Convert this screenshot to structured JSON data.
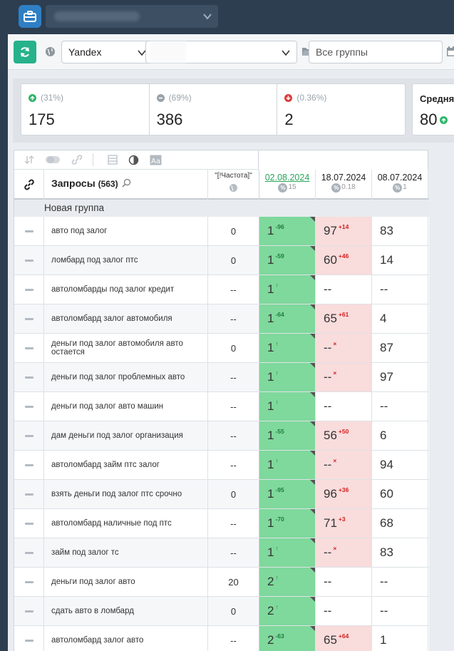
{
  "toolbar": {
    "search_engine": "Yandex",
    "group_placeholder": "Все группы"
  },
  "stats": [
    {
      "pct": "(31%)",
      "value": "175",
      "type": "up",
      "color": "#2fb66a"
    },
    {
      "pct": "(69%)",
      "value": "386",
      "type": "same",
      "color": "#9aa3ab"
    },
    {
      "pct": "(0.36%)",
      "value": "2",
      "type": "down",
      "color": "#e03b3b"
    }
  ],
  "avg": {
    "label": "Средня",
    "value": "80"
  },
  "table": {
    "query_header": "Запросы",
    "query_count": "(563)",
    "freq_header": "\"[!Частота]\"",
    "dates": [
      {
        "date": "02.08.2024",
        "sub": "15",
        "link": true
      },
      {
        "date": "18.07.2024",
        "sub": "0.18",
        "link": false
      },
      {
        "date": "08.07.2024",
        "sub": "1",
        "link": false
      }
    ],
    "group_name": "Новая группа",
    "rows": [
      {
        "query": "авто под залог",
        "freq": "0",
        "p1": "1",
        "p1c": "-96",
        "p1g": true,
        "p2": "97",
        "p2c": "+14",
        "p2r": true,
        "p3": "83"
      },
      {
        "query": "ломбард под залог птс",
        "freq": "0",
        "p1": "1",
        "p1c": "-59",
        "p1g": true,
        "p2": "60",
        "p2c": "+46",
        "p2r": true,
        "p3": "14"
      },
      {
        "query": "автоломбарды под залог кредит",
        "freq": "--",
        "p1": "1",
        "p1c": "↑",
        "p1g": true,
        "p2": "--",
        "p2c": "",
        "p2r": false,
        "p3": "--"
      },
      {
        "query": "автоломбард залог автомобиля",
        "freq": "--",
        "p1": "1",
        "p1c": "-64",
        "p1g": true,
        "p2": "65",
        "p2c": "+61",
        "p2r": true,
        "p3": "4"
      },
      {
        "query": "деньги под залог автомобиля авто остается",
        "freq": "0",
        "p1": "1",
        "p1c": "↑",
        "p1g": true,
        "p2": "--",
        "p2c": "×",
        "p2r": true,
        "p3": "87"
      },
      {
        "query": "деньги под залог проблемных авто",
        "freq": "--",
        "p1": "1",
        "p1c": "↑",
        "p1g": true,
        "p2": "--",
        "p2c": "×",
        "p2r": true,
        "p3": "97"
      },
      {
        "query": "деньги под залог авто машин",
        "freq": "--",
        "p1": "1",
        "p1c": "↑",
        "p1g": true,
        "p2": "--",
        "p2c": "",
        "p2r": false,
        "p3": "--"
      },
      {
        "query": "дам деньги под залог организация",
        "freq": "--",
        "p1": "1",
        "p1c": "-55",
        "p1g": true,
        "p2": "56",
        "p2c": "+50",
        "p2r": true,
        "p3": "6"
      },
      {
        "query": "автоломбард займ птс залог",
        "freq": "--",
        "p1": "1",
        "p1c": "↑",
        "p1g": true,
        "p2": "--",
        "p2c": "×",
        "p2r": true,
        "p3": "94"
      },
      {
        "query": "взять деньги под залог птс срочно",
        "freq": "0",
        "p1": "1",
        "p1c": "-95",
        "p1g": true,
        "p2": "96",
        "p2c": "+36",
        "p2r": true,
        "p3": "60"
      },
      {
        "query": "автоломбард наличные под птс",
        "freq": "--",
        "p1": "1",
        "p1c": "-70",
        "p1g": true,
        "p2": "71",
        "p2c": "+3",
        "p2r": true,
        "p3": "68"
      },
      {
        "query": "займ под залог тс",
        "freq": "--",
        "p1": "1",
        "p1c": "↑",
        "p1g": true,
        "p2": "--",
        "p2c": "×",
        "p2r": true,
        "p3": "83"
      },
      {
        "query": "деньги под залог авто",
        "freq": "20",
        "p1": "2",
        "p1c": "↑",
        "p1g": true,
        "p2": "--",
        "p2c": "",
        "p2r": false,
        "p3": "--"
      },
      {
        "query": "сдать авто в ломбард",
        "freq": "0",
        "p1": "2",
        "p1c": "↑",
        "p1g": true,
        "p2": "--",
        "p2c": "",
        "p2r": false,
        "p3": "--"
      },
      {
        "query": "автоломбард залог авто",
        "freq": "--",
        "p1": "2",
        "p1c": "-63",
        "p1g": true,
        "p2": "65",
        "p2c": "+64",
        "p2r": true,
        "p3": "1"
      }
    ]
  }
}
